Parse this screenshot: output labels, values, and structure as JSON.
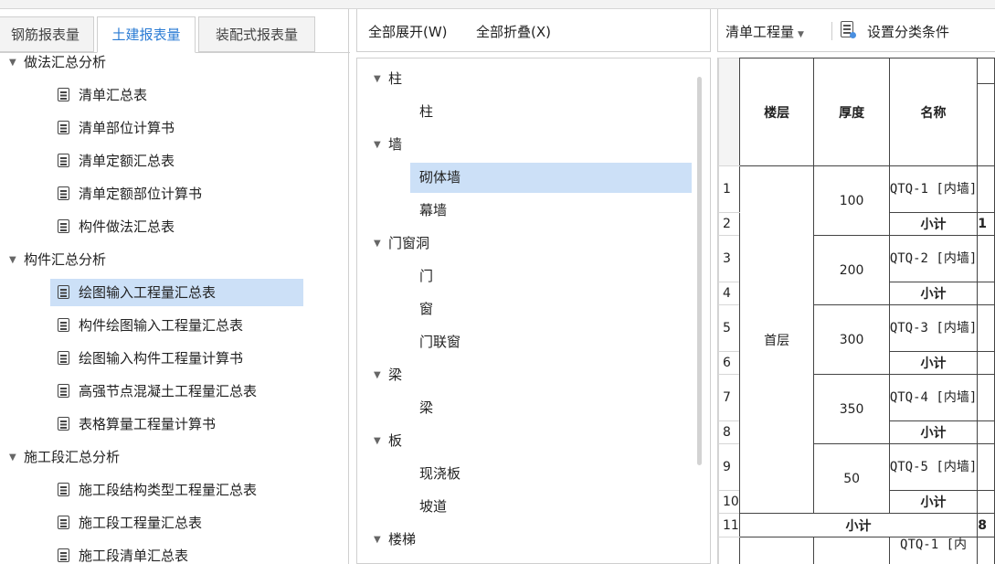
{
  "left": {
    "tabs": [
      "钢筋报表量",
      "土建报表量",
      "装配式报表量"
    ],
    "tree": [
      {
        "label": "做法汇总分析",
        "type": "group"
      },
      {
        "label": "清单汇总表",
        "type": "item"
      },
      {
        "label": "清单部位计算书",
        "type": "item"
      },
      {
        "label": "清单定额汇总表",
        "type": "item"
      },
      {
        "label": "清单定额部位计算书",
        "type": "item"
      },
      {
        "label": "构件做法汇总表",
        "type": "item"
      },
      {
        "label": "构件汇总分析",
        "type": "group"
      },
      {
        "label": "绘图输入工程量汇总表",
        "type": "item",
        "selected": true
      },
      {
        "label": "构件绘图输入工程量汇总表",
        "type": "item"
      },
      {
        "label": "绘图输入构件工程量计算书",
        "type": "item"
      },
      {
        "label": "高强节点混凝土工程量汇总表",
        "type": "item"
      },
      {
        "label": "表格算量工程量计算书",
        "type": "item"
      },
      {
        "label": "施工段汇总分析",
        "type": "group"
      },
      {
        "label": "施工段结构类型工程量汇总表",
        "type": "item"
      },
      {
        "label": "施工段工程量汇总表",
        "type": "item"
      },
      {
        "label": "施工段清单汇总表",
        "type": "item"
      }
    ]
  },
  "mid": {
    "expand_all": "全部展开(W)",
    "collapse_all": "全部折叠(X)",
    "tree": [
      {
        "label": "柱",
        "type": "group"
      },
      {
        "label": "柱",
        "type": "item"
      },
      {
        "label": "墙",
        "type": "group"
      },
      {
        "label": "砌体墙",
        "type": "item",
        "selected": true
      },
      {
        "label": "幕墙",
        "type": "item"
      },
      {
        "label": "门窗洞",
        "type": "group"
      },
      {
        "label": "门",
        "type": "item"
      },
      {
        "label": "窗",
        "type": "item"
      },
      {
        "label": "门联窗",
        "type": "item"
      },
      {
        "label": "梁",
        "type": "group"
      },
      {
        "label": "梁",
        "type": "item"
      },
      {
        "label": "板",
        "type": "group"
      },
      {
        "label": "现浇板",
        "type": "item"
      },
      {
        "label": "坡道",
        "type": "item"
      },
      {
        "label": "楼梯",
        "type": "group"
      }
    ]
  },
  "right": {
    "dropdown": "清单工程量",
    "set_condition": "设置分类条件",
    "headers": {
      "floor": "楼层",
      "thickness": "厚度",
      "name": "名称"
    },
    "floor": "首层",
    "rows": [
      {
        "n": "1",
        "thickness": "100",
        "name": "QTQ-1 [内墙]"
      },
      {
        "n": "2",
        "subtotal": "小计",
        "partial": "1"
      },
      {
        "n": "3",
        "thickness": "200",
        "name": "QTQ-2 [内墙]"
      },
      {
        "n": "4",
        "subtotal": "小计"
      },
      {
        "n": "5",
        "thickness": "300",
        "name": "QTQ-3 [内墙]"
      },
      {
        "n": "6",
        "subtotal": "小计"
      },
      {
        "n": "7",
        "thickness": "350",
        "name": "QTQ-4 [内墙]"
      },
      {
        "n": "8",
        "subtotal": "小计"
      },
      {
        "n": "9",
        "thickness": "50",
        "name": "QTQ-5 [内墙]"
      },
      {
        "n": "10",
        "subtotal": "小计"
      },
      {
        "n": "11",
        "subtotal": "小计",
        "partial": "8"
      }
    ],
    "next_name": "QTQ-1 [内"
  }
}
